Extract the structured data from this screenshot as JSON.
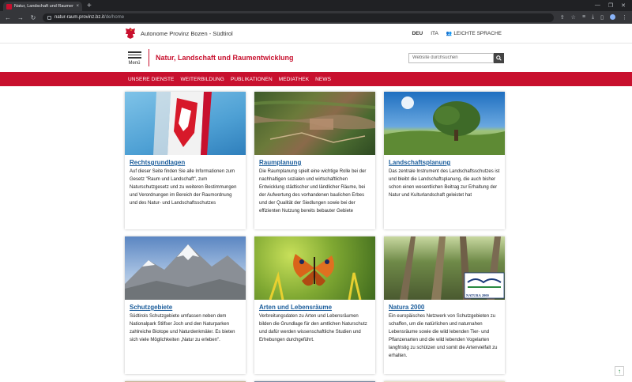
{
  "browser": {
    "tab_title": "Natur, Landschaft und Raumentw...",
    "tab_close": "×",
    "new_tab": "+",
    "url_host": "natur-raum.provinz.bz.it",
    "url_path": "/de/home"
  },
  "header": {
    "province": "Autonome Provinz Bozen - Südtirol",
    "lang_de": "DEU",
    "lang_it": "ITA",
    "easy_language": "LEICHTE SPRACHE",
    "menu_label": "Menü",
    "site_title": "Natur, Landschaft und Raumentwicklung",
    "search_placeholder": "Website durchsuchen"
  },
  "nav": {
    "items": [
      "UNSERE DIENSTE",
      "WEITERBILDUNG",
      "PUBLIKATIONEN",
      "MEDIATHEK",
      "NEWS"
    ]
  },
  "cards": [
    {
      "title": "Rechtsgrundlagen",
      "text": "Auf dieser Seite finden Sie alle Informationen zum Gesetz \"Raum und Landschaft\", zum Naturschutzgesetz und zu weiteren Bestimmungen und Verordnungen im Bereich der Raumordnung und des Natur- und Landschaftsschutzes"
    },
    {
      "title": "Raumplanung",
      "text": "Die Raumplanung spielt eine wichtige Rolle bei der nachhaltigen sozialen und wirtschaftlichen Entwicklung städtischer und ländlicher Räume, bei der Aufwertung des vorhandenen baulichen Erbes und der Qualität der Siedlungen sowie bei der effizienten Nutzung bereits bebauter Gebiete"
    },
    {
      "title": "Landschaftsplanung",
      "text": "Das zentrale Instrument des Landschaftsschutzes ist und bleibt die Landschaftsplanung, die auch bisher schon einen wesentlichen Beitrag zur Erhaltung der Natur und Kulturlandschaft geleistet hat"
    },
    {
      "title": "Schutzgebiete",
      "text": "Südtirols Schutzgebiete umfassen neben dem Nationalpark Stilfser Joch und den Naturparken zahlreiche Biotope und Naturdenkmäler. Es bieten sich viele Möglichkeiten „Natur zu erleben\"."
    },
    {
      "title": "Arten und Lebensräume",
      "text": "Verbreitungsdaten zu Arten und Lebensräumen bilden die Grundlage für den amtlichen Naturschutz und dafür werden wissenschaftliche Studien und Erhebungen durchgeführt."
    },
    {
      "title": "Natura 2000",
      "text": "Ein europäisches Netzwerk von Schutzgebieten zu schaffen, um die natürlichen und naturnahen Lebensräume sowie die wild lebenden Tier- und Pflanzenarten und die wild lebenden Vogelarten langfristig zu schützen und somit die Artenvielfalt zu erhalten.",
      "logo_text": "NATURA 2000"
    }
  ],
  "colors": {
    "brand_red": "#c8102e",
    "link_blue": "#1b5d9b"
  }
}
